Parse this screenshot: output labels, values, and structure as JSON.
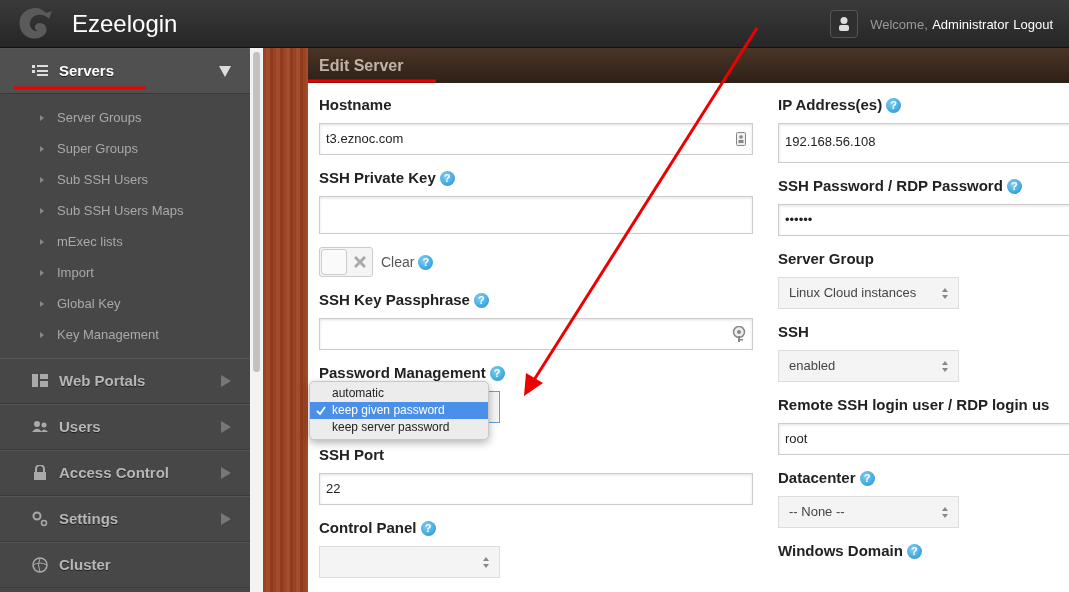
{
  "header": {
    "brand": "Ezeelogin",
    "welcome": "Welcome,",
    "user": "Administrator",
    "logout": "Logout"
  },
  "sidebar": {
    "items": [
      {
        "label": "Servers",
        "expanded": true,
        "children": [
          {
            "label": "Server Groups"
          },
          {
            "label": "Super Groups"
          },
          {
            "label": "Sub SSH Users"
          },
          {
            "label": "Sub SSH Users Maps"
          },
          {
            "label": "mExec lists"
          },
          {
            "label": "Import"
          },
          {
            "label": "Global Key"
          },
          {
            "label": "Key Management"
          }
        ]
      },
      {
        "label": "Web Portals",
        "expanded": false
      },
      {
        "label": "Users",
        "expanded": false
      },
      {
        "label": "Access Control",
        "expanded": false
      },
      {
        "label": "Settings",
        "expanded": false
      },
      {
        "label": "Cluster"
      }
    ]
  },
  "panel": {
    "title": "Edit Server"
  },
  "form": {
    "left": [
      {
        "kind": "text-card",
        "label": "Hostname",
        "value": "t3.eznoc.com"
      },
      {
        "kind": "textarea",
        "label": "SSH Private Key",
        "help": "?"
      },
      {
        "kind": "toggle",
        "label": "Clear",
        "on": false,
        "help": "?"
      },
      {
        "kind": "text-key",
        "label": "SSH Key Passphrase",
        "help": "?"
      },
      {
        "kind": "select-open",
        "label": "Password Management",
        "help": "?",
        "options": [
          {
            "label": "automatic",
            "selected": false
          },
          {
            "label": "keep given password",
            "selected": true
          },
          {
            "label": "keep server password",
            "selected": false
          }
        ]
      },
      {
        "kind": "text",
        "label": "SSH Port",
        "value": "22"
      },
      {
        "kind": "select",
        "label": "Control Panel",
        "help": "?"
      }
    ],
    "right": [
      {
        "kind": "textarea",
        "label": "IP Address(es)",
        "help": "?",
        "value": "192.168.56.108"
      },
      {
        "kind": "text",
        "label": "SSH Password / RDP Password",
        "help": "?",
        "value": "••••••"
      },
      {
        "kind": "select",
        "label": "Server Group",
        "value": "Linux Cloud instances"
      },
      {
        "kind": "select",
        "label": "SSH",
        "value": "enabled"
      },
      {
        "kind": "text",
        "label": "Remote SSH login user / RDP login us",
        "value": "root"
      },
      {
        "kind": "select",
        "label": "Datacenter",
        "help": "?",
        "value": "-- None --"
      },
      {
        "kind": "label",
        "label": "Windows Domain",
        "help": "?"
      }
    ]
  }
}
